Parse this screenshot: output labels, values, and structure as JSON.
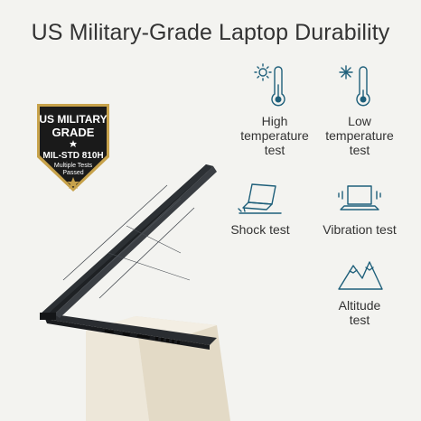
{
  "title": "US Military-Grade Laptop Durability",
  "badge": {
    "line1": "US MILITARY",
    "line2": "GRADE",
    "line3": "MIL-STD 810H",
    "line4": "Multiple Tests",
    "line5": "Passed"
  },
  "features": {
    "high_temp": {
      "line1": "High",
      "line2": "temperature",
      "line3": "test"
    },
    "low_temp": {
      "line1": "Low",
      "line2": "temperature",
      "line3": "test"
    },
    "shock": {
      "line1": "Shock test"
    },
    "vibration": {
      "line1": "Vibration test"
    },
    "altitude": {
      "line1": "Altitude",
      "line2": "test"
    }
  },
  "colors": {
    "icon_blue": "#1e5f7a",
    "badge_dark": "#1a1a1a",
    "badge_gold": "#c7a24b"
  }
}
